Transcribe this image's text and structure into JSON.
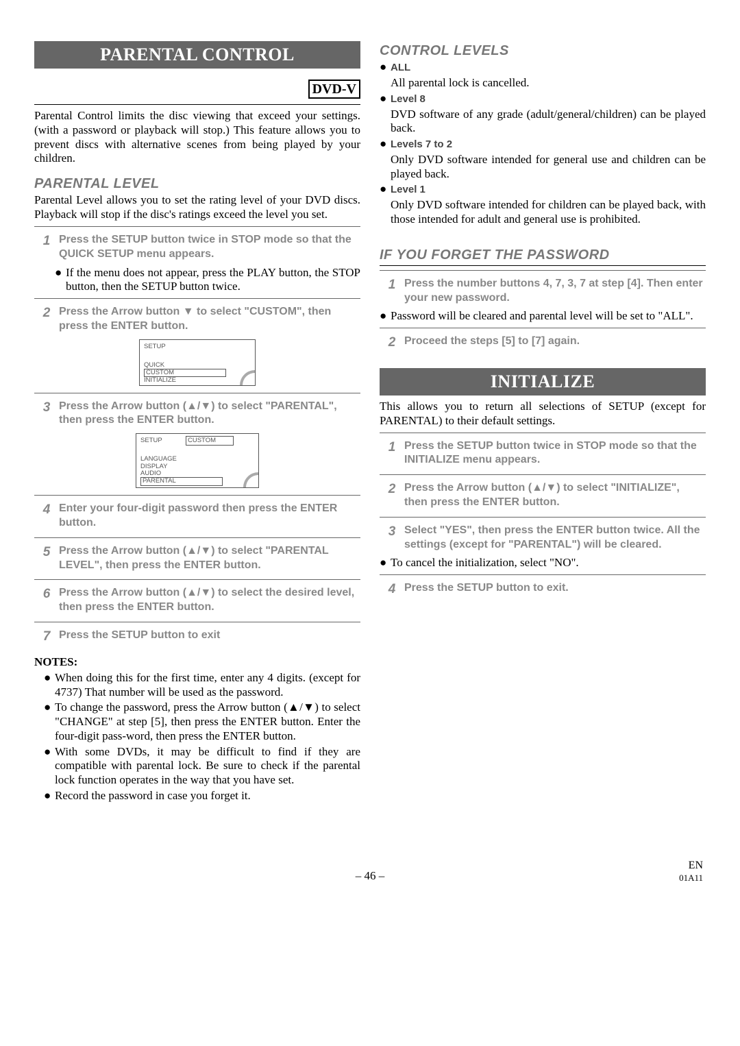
{
  "left": {
    "title": "PARENTAL CONTROL",
    "badge": "DVD-V",
    "intro": "Parental Control limits the disc viewing that exceed your settings. (with a password or playback will stop.) This feature allows you to prevent discs with alternative scenes from being played by your children.",
    "subhead": "PARENTAL LEVEL",
    "sub_intro": "Parental Level allows you to set the rating level of your DVD discs. Playback will stop if the disc's ratings exceed the level you set.",
    "steps": {
      "1": "Press the SETUP button twice in STOP mode so that the QUICK SETUP menu appears.",
      "b1": "If the menu does not appear, press the PLAY button, the STOP button, then the SETUP button twice.",
      "2": "Press the Arrow button ▼ to select \"CUSTOM\", then press the ENTER button.",
      "3": "Press the Arrow button (▲/▼) to select \"PARENTAL\", then press the ENTER button.",
      "4": "Enter your four-digit password then press the ENTER button.",
      "5": "Press the Arrow button (▲/▼) to select \"PARENTAL LEVEL\", then press the ENTER button.",
      "6": "Press the Arrow button (▲/▼) to select the desired level, then press the ENTER button.",
      "7": "Press the SETUP button to exit"
    },
    "diagram1": {
      "title": "SETUP",
      "items": [
        "QUICK",
        "CUSTOM",
        "INITIALIZE"
      ]
    },
    "diagram2": {
      "title": "SETUP",
      "box": "CUSTOM",
      "items": [
        "LANGUAGE",
        "DISPLAY",
        "AUDIO",
        "PARENTAL"
      ]
    },
    "notes_head": "NOTES:",
    "notes": [
      "When doing this for the first time, enter any 4 digits. (except for 4737) That number will be used as the password.",
      "To change the password, press the Arrow button (▲/▼) to select \"CHANGE\" at step [5], then press the ENTER button. Enter the four-digit pass-word, then press the ENTER button.",
      "With some DVDs, it may be difficult to find if they are compatible with parental lock. Be sure to check if the parental lock function operates in the way that you have set.",
      "Record the password in case you forget it."
    ]
  },
  "right": {
    "subhead1": "CONTROL LEVELS",
    "levels": {
      "all_h": "ALL",
      "all_t": "All parental lock is cancelled.",
      "l8_h": "Level 8",
      "l8_t": "DVD software of any grade (adult/general/children) can be played back.",
      "l72_h": "Levels 7 to 2",
      "l72_t": "Only DVD software intended for general use and children can be played back.",
      "l1_h": "Level 1",
      "l1_t": "Only DVD software intended for children can be played back, with those intended for adult and general use is prohibited."
    },
    "subhead2": "IF YOU FORGET THE PASSWORD",
    "forget": {
      "1": "Press the number buttons 4, 7, 3, 7 at step [4]. Then enter your new password.",
      "b1": "Password will be cleared and parental level will be set to \"ALL\".",
      "2": "Proceed the steps [5] to [7] again."
    },
    "title": "INITIALIZE",
    "init_intro": "This allows you to return all selections of SETUP (except for PARENTAL) to their default settings.",
    "init_steps": {
      "1": "Press the SETUP button twice in STOP mode so that the INITIALIZE menu appears.",
      "2": "Press the Arrow button (▲/▼) to select \"INITIALIZE\", then press the ENTER button.",
      "3": "Select \"YES\", then press the ENTER button twice. All the settings (except for \"PARENTAL\") will be cleared.",
      "b3": "To cancel the initialization, select \"NO\".",
      "4": "Press the SETUP button to exit."
    }
  },
  "footer": {
    "page": "– 46 –",
    "right1": "EN",
    "right2": "01A11"
  }
}
